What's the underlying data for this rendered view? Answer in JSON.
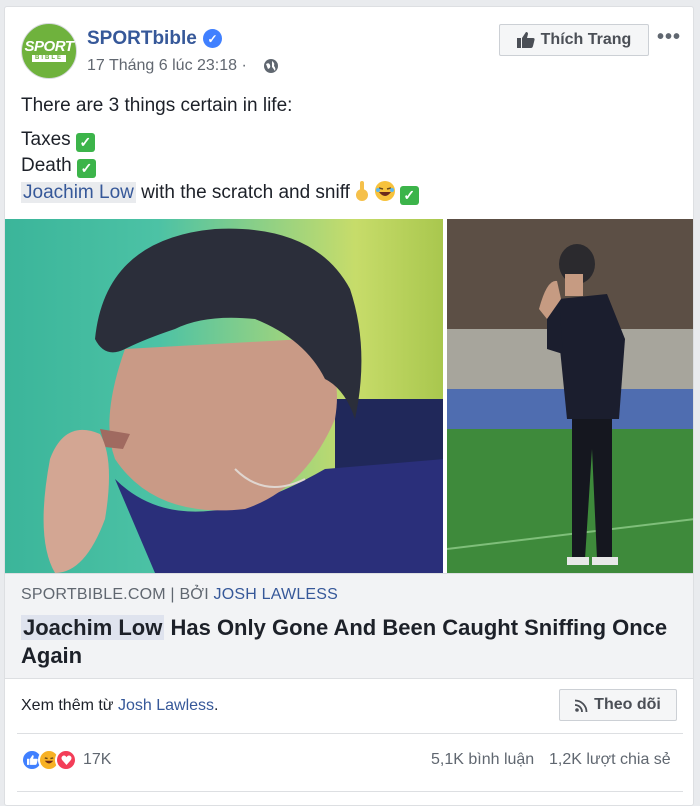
{
  "post": {
    "page_name": "SPORTbible",
    "avatar_text_top": "SPORT",
    "avatar_text_bottom": "BIBLE",
    "timestamp": "17 Tháng 6 lúc 23:18 ·",
    "like_page_label": "Thích Trang",
    "more_label": "•••",
    "text_line1": "There are 3 things certain in life:",
    "text_line2": "Taxes",
    "text_line3": "Death",
    "text_line4_mention": "Joachim Low",
    "text_line4_rest": " with the scratch and sniff"
  },
  "link": {
    "source": "SPORTBIBLE.COM",
    "separator": "|",
    "by_label": "BỞI",
    "author": "JOSH LAWLESS",
    "title_highlight": "Joachim Low",
    "title_rest": " Has Only Gone And Been Caught Sniffing Once Again"
  },
  "footer": {
    "see_more_prefix": "Xem thêm từ ",
    "see_more_author": "Josh Lawless",
    "see_more_suffix": ".",
    "follow_label": "Theo dõi",
    "reaction_count": "17K",
    "comments": "5,1K bình luận",
    "shares": "1,2K lượt chia sẻ"
  },
  "icons": {
    "verified": "verified-badge-icon",
    "globe": "globe-icon",
    "thumbs_up": "thumbs-up-icon",
    "rss": "rss-icon",
    "check": "check-mark-emoji",
    "hand": "pointing-hand-emoji",
    "laugh": "laughing-face-emoji"
  },
  "colors": {
    "link_blue": "#365899",
    "verified_blue": "#4080ff",
    "check_green": "#3cb44a"
  }
}
